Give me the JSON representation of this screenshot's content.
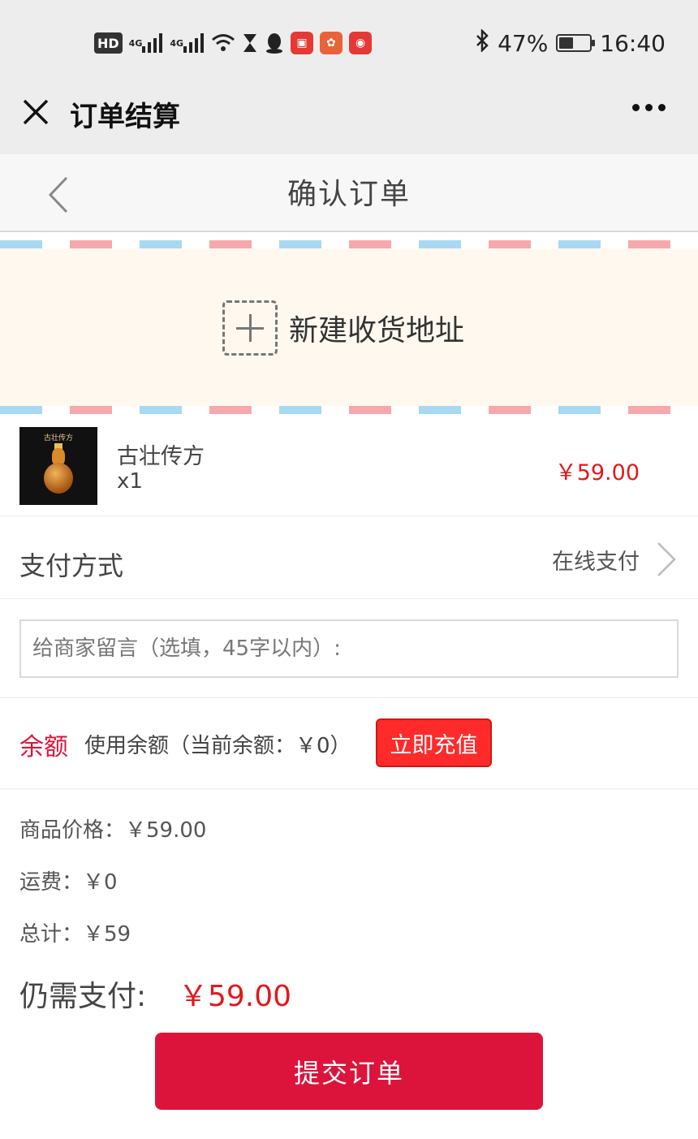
{
  "status_bar": {
    "hd_label": "HD",
    "network_1": "4G",
    "network_2": "4G",
    "battery_percent": "47%",
    "battery_level": 0.47,
    "time": "16:40",
    "icons": [
      "hd-icon",
      "signal-icon",
      "signal-icon",
      "wifi-icon",
      "hourglass-icon",
      "qq-icon",
      "book-app-icon",
      "huawei-app-icon",
      "vmall-app-icon",
      "bluetooth-icon",
      "battery-icon"
    ]
  },
  "wechat_nav": {
    "title": "订单结算",
    "close_icon": "close-icon",
    "more_icon": "more-icon"
  },
  "header": {
    "title": "确认订单",
    "back_icon": "chevron-left-icon"
  },
  "address": {
    "add_label": "新建收货地址",
    "icon": "add-address-icon",
    "stripe_colors": [
      "#a9d8f2",
      "#f6a9ad"
    ]
  },
  "product": {
    "name": "古壮传方",
    "quantity": "x1",
    "price": "￥59.00",
    "image_text": "古壮传方"
  },
  "payment": {
    "label": "支付方式",
    "value": "在线支付"
  },
  "message": {
    "placeholder": "给商家留言（选填，45字以内）:",
    "value": ""
  },
  "balance": {
    "tag": "余额",
    "text": "使用余额（当前余额：￥0）",
    "recharge_label": "立即充值"
  },
  "summary": {
    "goods_price": "商品价格：￥59.00",
    "shipping": "运费：￥0",
    "total": "总计：￥59",
    "need_pay_label": "仍需支付:",
    "need_pay_amount": "￥59.00"
  },
  "submit": {
    "label": "提交订单"
  },
  "colors": {
    "accent": "#dc143c",
    "price": "#e0191e",
    "address_bg": "#fff8ef"
  }
}
